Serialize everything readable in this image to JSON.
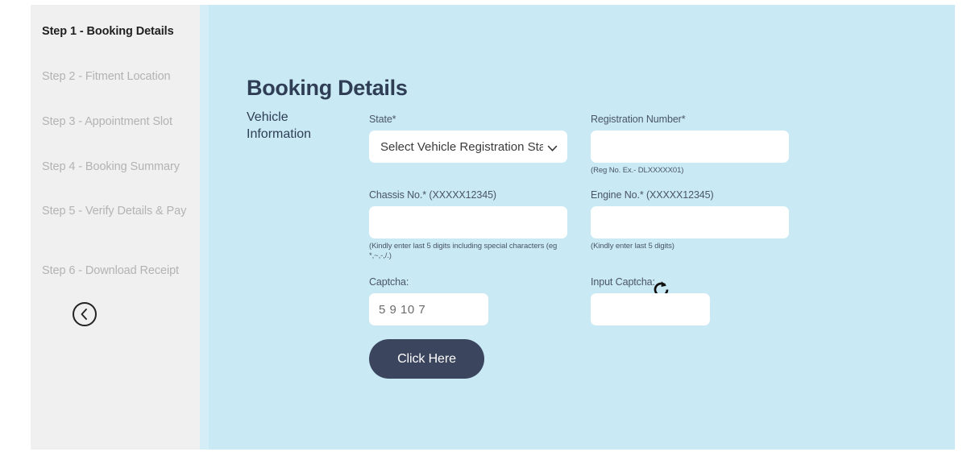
{
  "sidebar": {
    "steps": [
      {
        "label": "Step 1 - Booking Details",
        "active": true
      },
      {
        "label": "Step 2 - Fitment Location",
        "active": false
      },
      {
        "label": "Step 3 - Appointment Slot",
        "active": false
      },
      {
        "label": "Step 4 - Booking Summary",
        "active": false
      },
      {
        "label": "Step 5 - Verify Details & Pay",
        "active": false
      },
      {
        "label": "Step 6 - Download Receipt",
        "active": false
      }
    ],
    "back_icon": "chevron-left-circle-icon"
  },
  "main": {
    "title": "Booking Details",
    "section_label": "Vehicle Information",
    "fields": {
      "state": {
        "label": "State*",
        "selected": "Select Vehicle Registration Stat",
        "options": [
          "Select Vehicle Registration State"
        ]
      },
      "registration_number": {
        "label": "Registration Number*",
        "value": "",
        "hint": "(Reg No. Ex.- DLXXXXX01)"
      },
      "chassis_number": {
        "label": "Chassis No.* (XXXXX12345)",
        "value": "",
        "hint": "(Kindly enter last 5 digits including special characters (eg *,~,-,/.)"
      },
      "engine_number": {
        "label": "Engine No.* (XXXXX12345)",
        "value": "",
        "hint": "(Kindly enter last 5 digits)"
      },
      "captcha": {
        "label": "Captcha:",
        "value": "5 9  10 7",
        "refresh_icon": "refresh-icon"
      },
      "input_captcha": {
        "label": "Input Captcha:",
        "value": ""
      }
    },
    "submit_label": "Click Here"
  },
  "colors": {
    "panel_bg": "#c9e9f4",
    "panel_edge": "#d4edf7",
    "sidebar_bg": "#f0f0f0",
    "title": "#2f3e55",
    "button_bg": "#3b465e",
    "step_inactive": "#b3b3b3",
    "step_active": "#1f1f1f"
  }
}
